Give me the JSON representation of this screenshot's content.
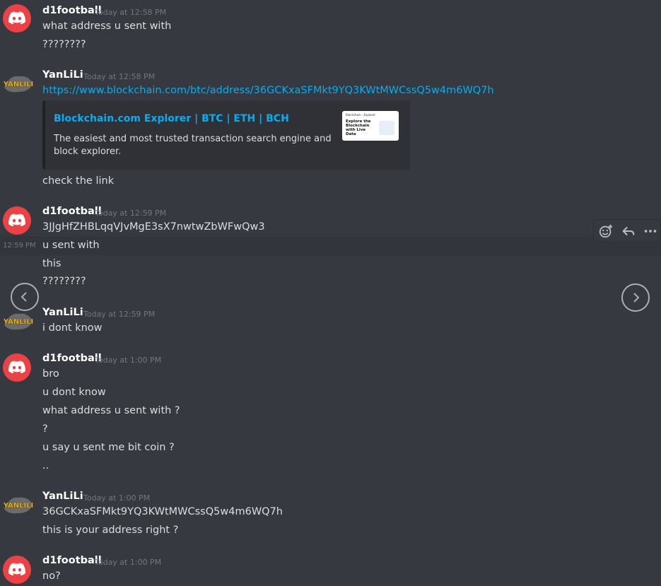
{
  "messages": [
    {
      "author": "d1football",
      "time": "Today at 12:58 PM",
      "lines": [
        "what address u sent with",
        "????????"
      ]
    },
    {
      "author": "YanLiLi",
      "time": "Today at 12:58 PM",
      "link": "https://www.blockchain.com/btc/address/36GCKxaSFMkt9YQ3KWtMWCssQ5w4m6WQ7h",
      "embed": {
        "title": "Blockchain.com Explorer | BTC | ETH | BCH",
        "description": "The easiest and most trusted transaction search engine and block explorer.",
        "thumb_brand": "Blockchain · Explorer",
        "thumb_headline": "Explore the Blockchain with Live Data"
      },
      "after": "check the link"
    },
    {
      "author": "d1football",
      "time": "Today at 12:59 PM",
      "lines": [
        "3JJgHfZHBLqqVJvMgE3sX7nwtwZbWFwQw3",
        "u sent with",
        "this",
        "????????"
      ],
      "hover_time": "12:59 PM"
    },
    {
      "author": "YanLiLi",
      "time": "Today at 12:59 PM",
      "lines": [
        "i dont know"
      ]
    },
    {
      "author": "d1football",
      "time": "Today at 1:00 PM",
      "lines": [
        "bro",
        "u dont know",
        "what address u sent with ?",
        "?",
        "u say u sent me bit coin ?",
        ".."
      ]
    },
    {
      "author": "YanLiLi",
      "time": "Today at 1:00 PM",
      "lines": [
        "36GCKxaSFMkt9YQ3KWtMWCssQ5w4m6WQ7h",
        "this is your address right ?"
      ]
    },
    {
      "author": "d1football",
      "time": "Today at 1:00 PM",
      "lines": [
        "no?"
      ]
    }
  ],
  "yan_avatar_text": "YANLILI",
  "colors": {
    "background": "#36393f",
    "discord_red": "#ed4245",
    "link": "#00aff4"
  },
  "icons": [
    "add-reaction-icon",
    "reply-icon",
    "more-icon",
    "chevron-left-icon",
    "chevron-right-icon",
    "discord-logo-icon"
  ]
}
